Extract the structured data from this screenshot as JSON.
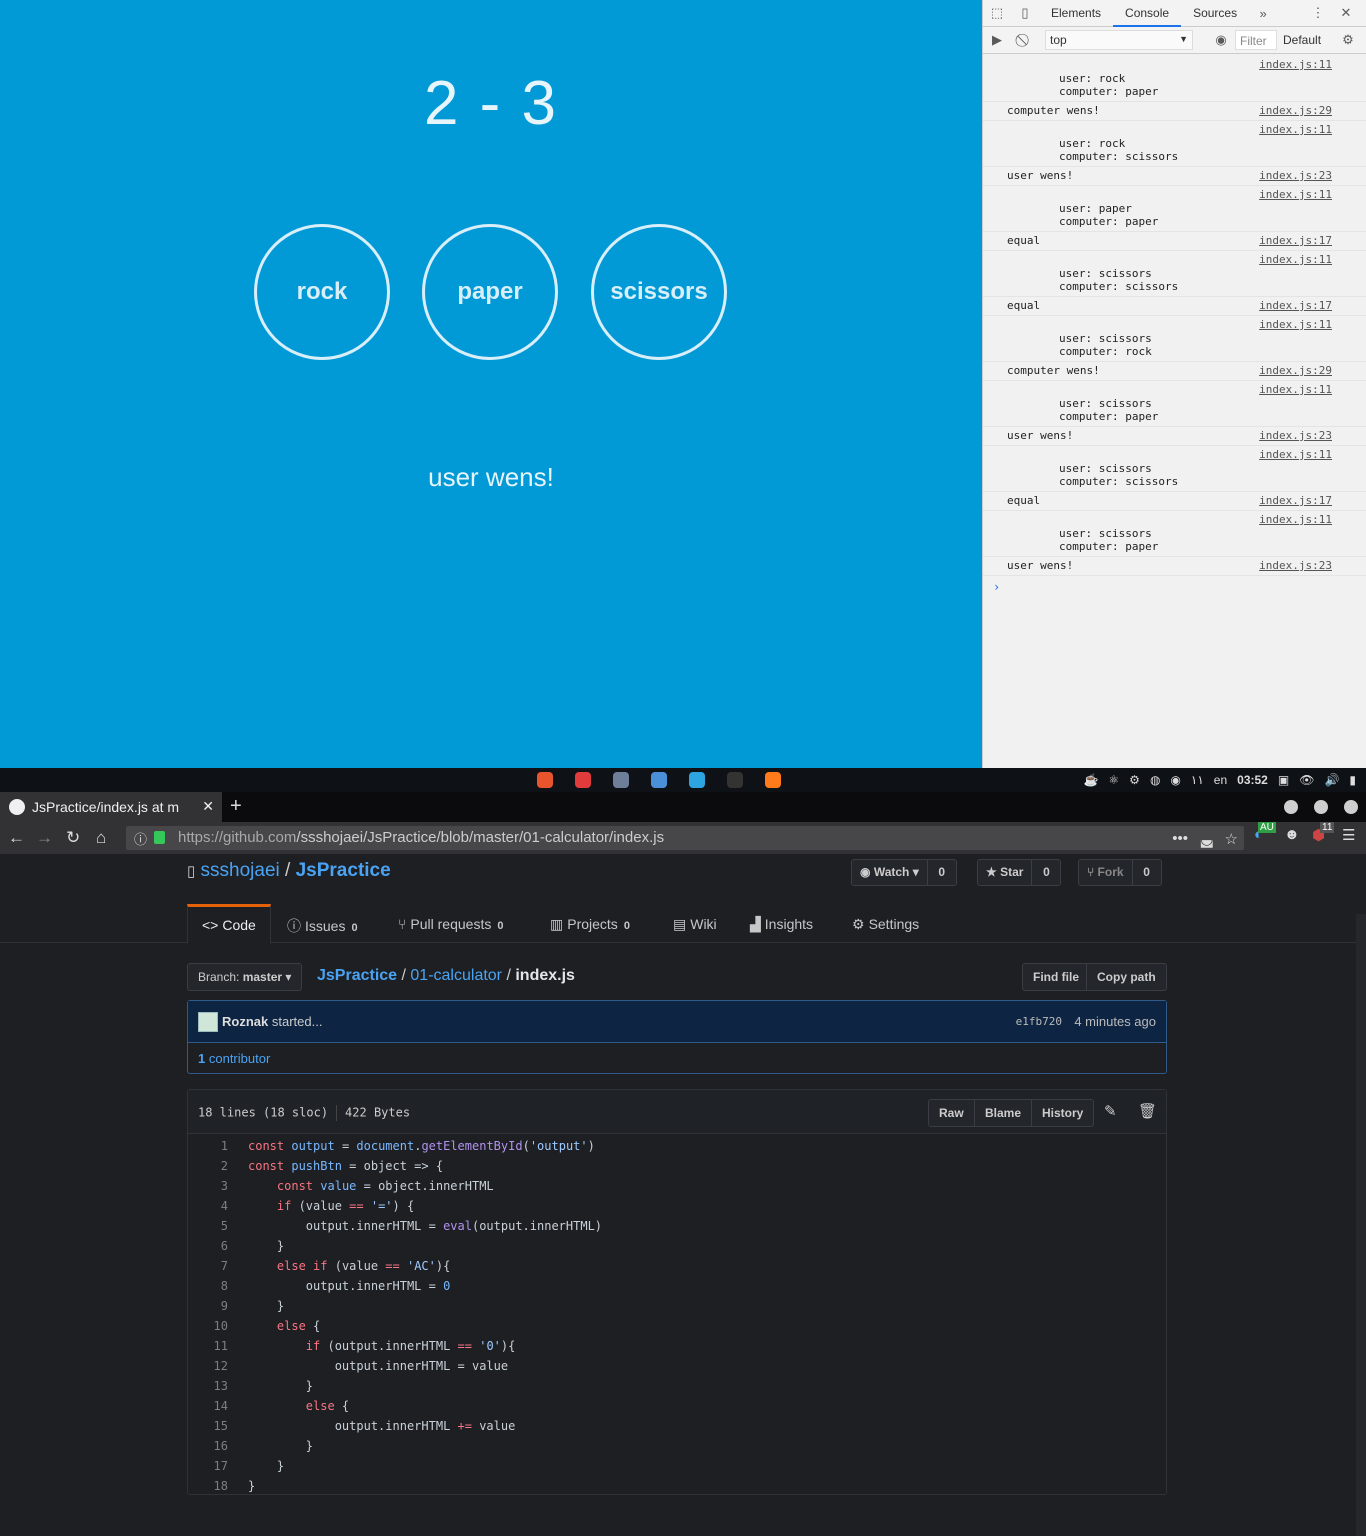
{
  "game": {
    "score": "2 - 3",
    "choices": [
      "rock",
      "paper",
      "scissors"
    ],
    "result": "user wens!"
  },
  "devtools": {
    "tabs": [
      "Elements",
      "Console",
      "Sources"
    ],
    "active_tab": "Console",
    "context": "top",
    "filter_placeholder": "Filter",
    "levels": "Default",
    "messages": [
      {
        "text": "user: rock\ncomputer: paper",
        "src": "index.js:11",
        "multi": true
      },
      {
        "text": "computer wens!",
        "src": "index.js:29",
        "multi": false
      },
      {
        "text": "user: rock\ncomputer: scissors",
        "src": "index.js:11",
        "multi": true
      },
      {
        "text": "user wens!",
        "src": "index.js:23",
        "multi": false
      },
      {
        "text": "user: paper\ncomputer: paper",
        "src": "index.js:11",
        "multi": true
      },
      {
        "text": "equal",
        "src": "index.js:17",
        "multi": false
      },
      {
        "text": "user: scissors\ncomputer: scissors",
        "src": "index.js:11",
        "multi": true
      },
      {
        "text": "equal",
        "src": "index.js:17",
        "multi": false
      },
      {
        "text": "user: scissors\ncomputer: rock",
        "src": "index.js:11",
        "multi": true
      },
      {
        "text": "computer wens!",
        "src": "index.js:29",
        "multi": false
      },
      {
        "text": "user: scissors\ncomputer: paper",
        "src": "index.js:11",
        "multi": true
      },
      {
        "text": "user wens!",
        "src": "index.js:23",
        "multi": false
      },
      {
        "text": "user: scissors\ncomputer: scissors",
        "src": "index.js:11",
        "multi": true
      },
      {
        "text": "equal",
        "src": "index.js:17",
        "multi": false
      },
      {
        "text": "user: scissors\ncomputer: paper",
        "src": "index.js:11",
        "multi": true
      },
      {
        "text": "user wens!",
        "src": "index.js:23",
        "multi": false
      }
    ],
    "prompt": "›"
  },
  "panel": {
    "lang": "en",
    "time": "03:52",
    "workspace": "١١",
    "tray_colors": [
      "#e8542e",
      "#e23b3b",
      "#6e7f99",
      "#4a90d9",
      "#2ca5e0",
      "#333333",
      "#ff7a1a"
    ]
  },
  "firefox": {
    "tab_title": "JsPractice/index.js at m",
    "url_host": "https://github.com",
    "url_path": "/ssshojaei/JsPractice/blob/master/01-calculator/index.js",
    "badge_au": "AU",
    "badge_count": "11"
  },
  "github": {
    "owner": "ssshojaei",
    "repo": "JsPractice",
    "watch": "Watch",
    "watch_count": "0",
    "star": "Star",
    "star_count": "0",
    "fork": "Fork",
    "fork_count": "0",
    "nav": [
      {
        "label": "Code",
        "icon": "<>",
        "count": ""
      },
      {
        "label": "Issues",
        "icon": "ⓘ",
        "count": "0"
      },
      {
        "label": "Pull requests",
        "icon": "⑂",
        "count": "0"
      },
      {
        "label": "Projects",
        "icon": "▥",
        "count": "0"
      },
      {
        "label": "Wiki",
        "icon": "▤",
        "count": ""
      },
      {
        "label": "Insights",
        "icon": "▟",
        "count": ""
      },
      {
        "label": "Settings",
        "icon": "⚙",
        "count": ""
      }
    ],
    "branch_label": "Branch:",
    "branch": "master",
    "crumbs": {
      "repo": "JsPractice",
      "dir": "01-calculator",
      "file": "index.js"
    },
    "find_file": "Find file",
    "copy_path": "Copy path",
    "commit": {
      "author": "Roznak",
      "message": "started...",
      "sha": "e1fb720",
      "when": "4 minutes ago"
    },
    "contributors": {
      "count": "1",
      "label": "contributor"
    },
    "file_info": {
      "lines": "18 lines (18 sloc)",
      "size": "422 Bytes"
    },
    "file_buttons": [
      "Raw",
      "Blame",
      "History"
    ],
    "code": [
      "const output = document.getElementById('output')",
      "const pushBtn = object => {",
      "    const value = object.innerHTML",
      "    if (value == '=') {",
      "        output.innerHTML = eval(output.innerHTML)",
      "    }",
      "    else if (value == 'AC'){",
      "        output.innerHTML = 0",
      "    }",
      "    else {",
      "        if (output.innerHTML == '0'){",
      "            output.innerHTML = value",
      "        }",
      "        else {",
      "            output.innerHTML += value",
      "        }",
      "    }",
      "}"
    ]
  }
}
